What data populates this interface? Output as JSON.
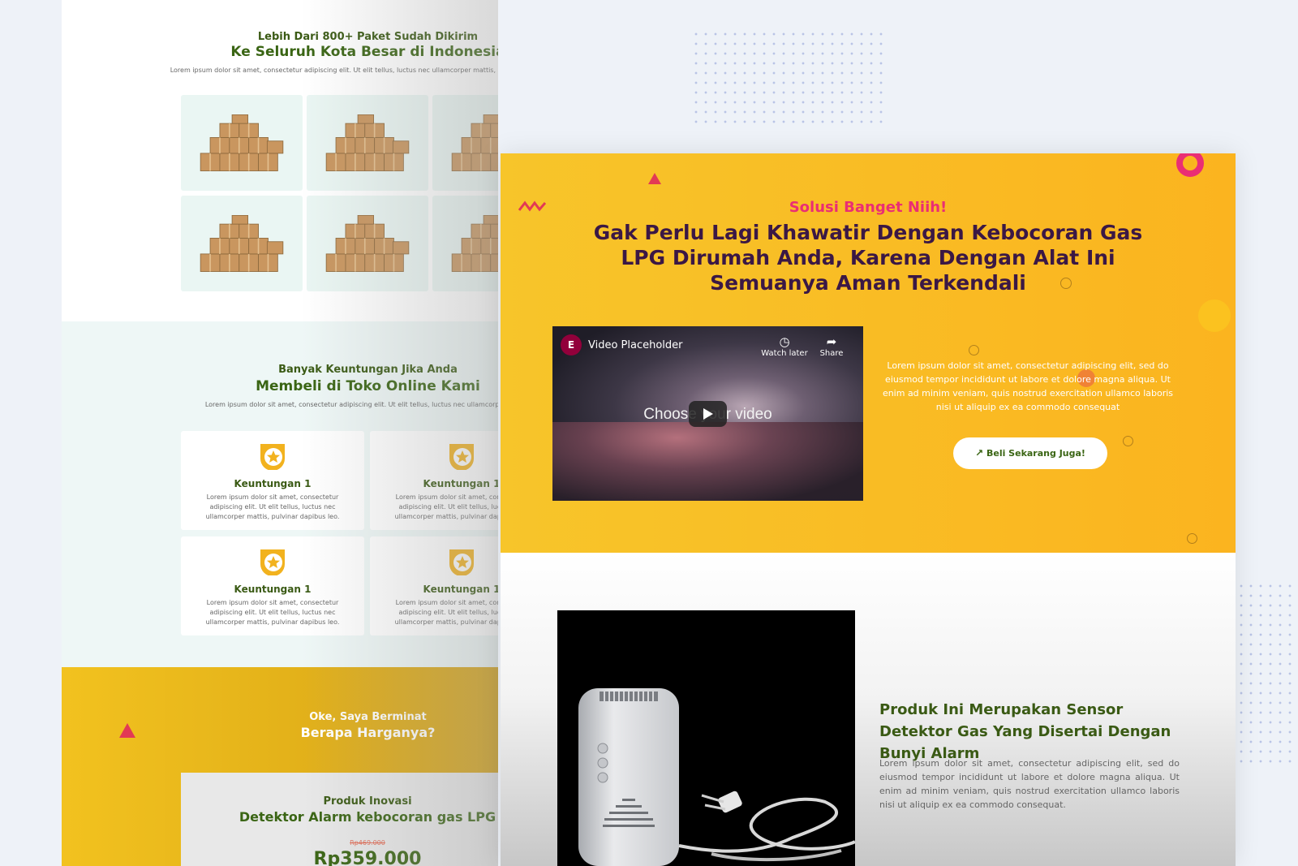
{
  "colors": {
    "green": "#3a6514",
    "pink": "#ea2e74",
    "yellow": "#f7c52a",
    "purple": "#3b1845"
  },
  "back_page": {
    "shipping": {
      "subtitle": "Lebih Dari 800+ Paket Sudah Dikirim",
      "title": "Ke Seluruh Kota Besar di Indonesia",
      "desc": "Lorem ipsum dolor sit amet, consectetur adipiscing elit. Ut elit tellus, luctus nec ullamcorper mattis, pulvinar dapibus leo.",
      "image_icon": "cardboard-boxes-icon"
    },
    "benefits": {
      "subtitle": "Banyak Keuntungan Jika Anda",
      "title": "Membeli di Toko Online Kami",
      "desc": "Lorem ipsum dolor sit amet, consectetur adipiscing elit. Ut elit tellus, luctus nec ullamcorper mattis,",
      "badge_icon": "star-badge-icon",
      "cards": [
        {
          "title": "Keuntungan 1",
          "desc": "Lorem ipsum dolor sit amet, consectetur adipiscing elit. Ut elit tellus, luctus nec ullamcorper mattis, pulvinar dapibus leo."
        },
        {
          "title": "Keuntungan 1",
          "desc": "Lorem ipsum dolor sit amet, consectetur adipiscing elit. Ut elit tellus, luctus nec ullamcorper mattis, pulvinar dapibus leo."
        },
        {
          "title": "Keuntungan 1",
          "desc": "Lorem ipsum dolor sit amet, consectetur adipiscing elit. Ut elit tellus, luctus nec ullamcorper mattis, pulvinar dapibus leo."
        },
        {
          "title": "Keuntungan 1",
          "desc": "Lorem ipsum dolor sit amet, consectetur adipiscing elit. Ut elit tellus, luctus nec ullamcorper mattis, pulvinar dapibus leo."
        }
      ]
    },
    "pricing": {
      "subtitle": "Oke, Saya Berminat",
      "title": "Berapa Harganya?",
      "product_label": "Produk Inovasi",
      "product_name": "Detektor Alarm kebocoran gas LPG",
      "old_price": "Rp469.000",
      "price": "Rp359.000"
    }
  },
  "front_page": {
    "hero": {
      "subtitle": "Solusi Banget Niih!",
      "title": "Gak Perlu Lagi Khawatir Dengan Kebocoran Gas LPG Dirumah Anda, Karena Dengan Alat Ini Semuanya Aman Terkendali",
      "desc": "Lorem ipsum dolor sit amet, consectetur adipiscing elit, sed do eiusmod tempor incididunt ut labore et dolore magna aliqua. Ut enim ad minim veniam, quis nostrud exercitation ullamco laboris nisi ut aliquip ex ea commodo consequat",
      "button_label": "Beli Sekarang Juga!",
      "button_icon": "external-link-icon"
    },
    "video": {
      "logo": "E",
      "title": "Video Placeholder",
      "watch_later": "Watch later",
      "share": "Share",
      "placeholder_text": "Choose your video",
      "play_icon": "play-icon"
    },
    "product": {
      "title": "Produk Ini Merupakan Sensor Detektor Gas Yang Disertai Dengan Bunyi Alarm",
      "desc": "Lorem ipsum dolor sit amet, consectetur adipiscing elit, sed do eiusmod tempor incididunt ut labore et dolore magna aliqua. Ut enim ad minim veniam, quis nostrud exercitation ullamco laboris nisi ut aliquip ex ea commodo consequat.",
      "image_icon": "gas-detector-device-icon"
    }
  }
}
